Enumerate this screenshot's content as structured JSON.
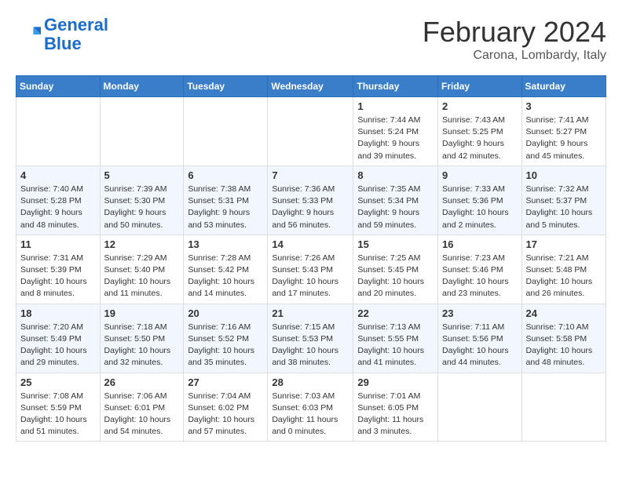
{
  "header": {
    "logo_line1": "General",
    "logo_line2": "Blue",
    "month": "February 2024",
    "location": "Carona, Lombardy, Italy"
  },
  "weekdays": [
    "Sunday",
    "Monday",
    "Tuesday",
    "Wednesday",
    "Thursday",
    "Friday",
    "Saturday"
  ],
  "weeks": [
    [
      {
        "day": "",
        "info": ""
      },
      {
        "day": "",
        "info": ""
      },
      {
        "day": "",
        "info": ""
      },
      {
        "day": "",
        "info": ""
      },
      {
        "day": "1",
        "info": "Sunrise: 7:44 AM\nSunset: 5:24 PM\nDaylight: 9 hours\nand 39 minutes."
      },
      {
        "day": "2",
        "info": "Sunrise: 7:43 AM\nSunset: 5:25 PM\nDaylight: 9 hours\nand 42 minutes."
      },
      {
        "day": "3",
        "info": "Sunrise: 7:41 AM\nSunset: 5:27 PM\nDaylight: 9 hours\nand 45 minutes."
      }
    ],
    [
      {
        "day": "4",
        "info": "Sunrise: 7:40 AM\nSunset: 5:28 PM\nDaylight: 9 hours\nand 48 minutes."
      },
      {
        "day": "5",
        "info": "Sunrise: 7:39 AM\nSunset: 5:30 PM\nDaylight: 9 hours\nand 50 minutes."
      },
      {
        "day": "6",
        "info": "Sunrise: 7:38 AM\nSunset: 5:31 PM\nDaylight: 9 hours\nand 53 minutes."
      },
      {
        "day": "7",
        "info": "Sunrise: 7:36 AM\nSunset: 5:33 PM\nDaylight: 9 hours\nand 56 minutes."
      },
      {
        "day": "8",
        "info": "Sunrise: 7:35 AM\nSunset: 5:34 PM\nDaylight: 9 hours\nand 59 minutes."
      },
      {
        "day": "9",
        "info": "Sunrise: 7:33 AM\nSunset: 5:36 PM\nDaylight: 10 hours\nand 2 minutes."
      },
      {
        "day": "10",
        "info": "Sunrise: 7:32 AM\nSunset: 5:37 PM\nDaylight: 10 hours\nand 5 minutes."
      }
    ],
    [
      {
        "day": "11",
        "info": "Sunrise: 7:31 AM\nSunset: 5:39 PM\nDaylight: 10 hours\nand 8 minutes."
      },
      {
        "day": "12",
        "info": "Sunrise: 7:29 AM\nSunset: 5:40 PM\nDaylight: 10 hours\nand 11 minutes."
      },
      {
        "day": "13",
        "info": "Sunrise: 7:28 AM\nSunset: 5:42 PM\nDaylight: 10 hours\nand 14 minutes."
      },
      {
        "day": "14",
        "info": "Sunrise: 7:26 AM\nSunset: 5:43 PM\nDaylight: 10 hours\nand 17 minutes."
      },
      {
        "day": "15",
        "info": "Sunrise: 7:25 AM\nSunset: 5:45 PM\nDaylight: 10 hours\nand 20 minutes."
      },
      {
        "day": "16",
        "info": "Sunrise: 7:23 AM\nSunset: 5:46 PM\nDaylight: 10 hours\nand 23 minutes."
      },
      {
        "day": "17",
        "info": "Sunrise: 7:21 AM\nSunset: 5:48 PM\nDaylight: 10 hours\nand 26 minutes."
      }
    ],
    [
      {
        "day": "18",
        "info": "Sunrise: 7:20 AM\nSunset: 5:49 PM\nDaylight: 10 hours\nand 29 minutes."
      },
      {
        "day": "19",
        "info": "Sunrise: 7:18 AM\nSunset: 5:50 PM\nDaylight: 10 hours\nand 32 minutes."
      },
      {
        "day": "20",
        "info": "Sunrise: 7:16 AM\nSunset: 5:52 PM\nDaylight: 10 hours\nand 35 minutes."
      },
      {
        "day": "21",
        "info": "Sunrise: 7:15 AM\nSunset: 5:53 PM\nDaylight: 10 hours\nand 38 minutes."
      },
      {
        "day": "22",
        "info": "Sunrise: 7:13 AM\nSunset: 5:55 PM\nDaylight: 10 hours\nand 41 minutes."
      },
      {
        "day": "23",
        "info": "Sunrise: 7:11 AM\nSunset: 5:56 PM\nDaylight: 10 hours\nand 44 minutes."
      },
      {
        "day": "24",
        "info": "Sunrise: 7:10 AM\nSunset: 5:58 PM\nDaylight: 10 hours\nand 48 minutes."
      }
    ],
    [
      {
        "day": "25",
        "info": "Sunrise: 7:08 AM\nSunset: 5:59 PM\nDaylight: 10 hours\nand 51 minutes."
      },
      {
        "day": "26",
        "info": "Sunrise: 7:06 AM\nSunset: 6:01 PM\nDaylight: 10 hours\nand 54 minutes."
      },
      {
        "day": "27",
        "info": "Sunrise: 7:04 AM\nSunset: 6:02 PM\nDaylight: 10 hours\nand 57 minutes."
      },
      {
        "day": "28",
        "info": "Sunrise: 7:03 AM\nSunset: 6:03 PM\nDaylight: 11 hours\nand 0 minutes."
      },
      {
        "day": "29",
        "info": "Sunrise: 7:01 AM\nSunset: 6:05 PM\nDaylight: 11 hours\nand 3 minutes."
      },
      {
        "day": "",
        "info": ""
      },
      {
        "day": "",
        "info": ""
      }
    ]
  ]
}
